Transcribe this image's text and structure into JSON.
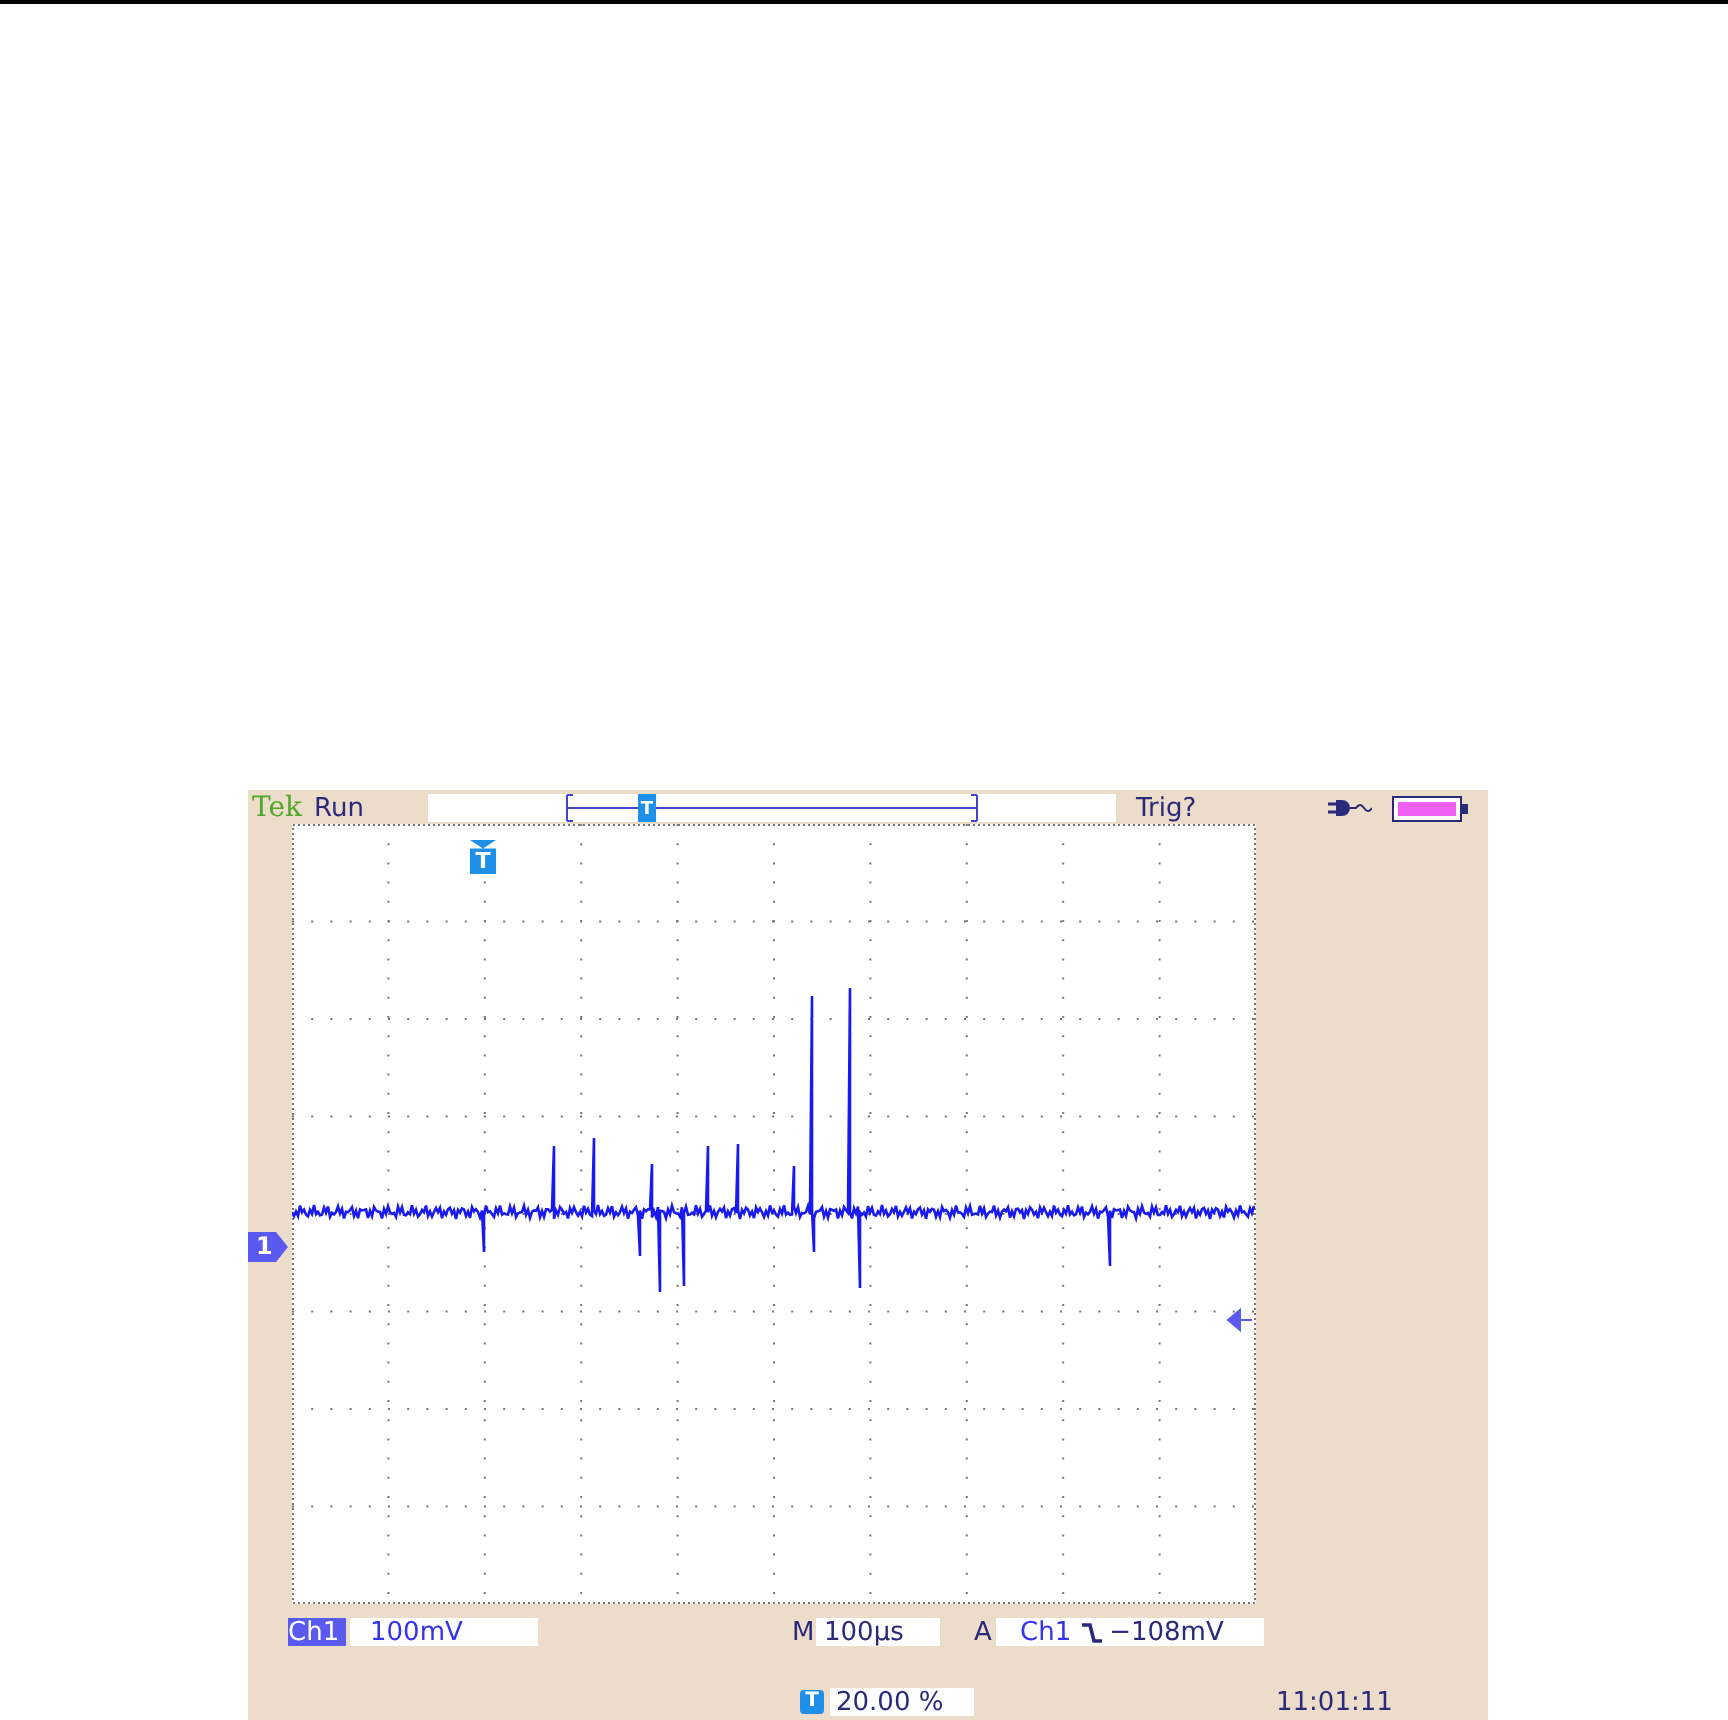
{
  "status_bar": {
    "brand": "Tek",
    "run_state": "Run",
    "trigger_state": "Trig?"
  },
  "channel": {
    "label": "Ch1",
    "scale": "100mV",
    "marker": "1"
  },
  "timebase": {
    "prefix": "M",
    "value": "100µs"
  },
  "trigger": {
    "prefix": "A",
    "source": "Ch1",
    "level": "−108mV",
    "marker": "T"
  },
  "trigger_position": {
    "marker": "T",
    "icon": "T",
    "value": "20.00 %"
  },
  "clock": "11:01:11"
}
